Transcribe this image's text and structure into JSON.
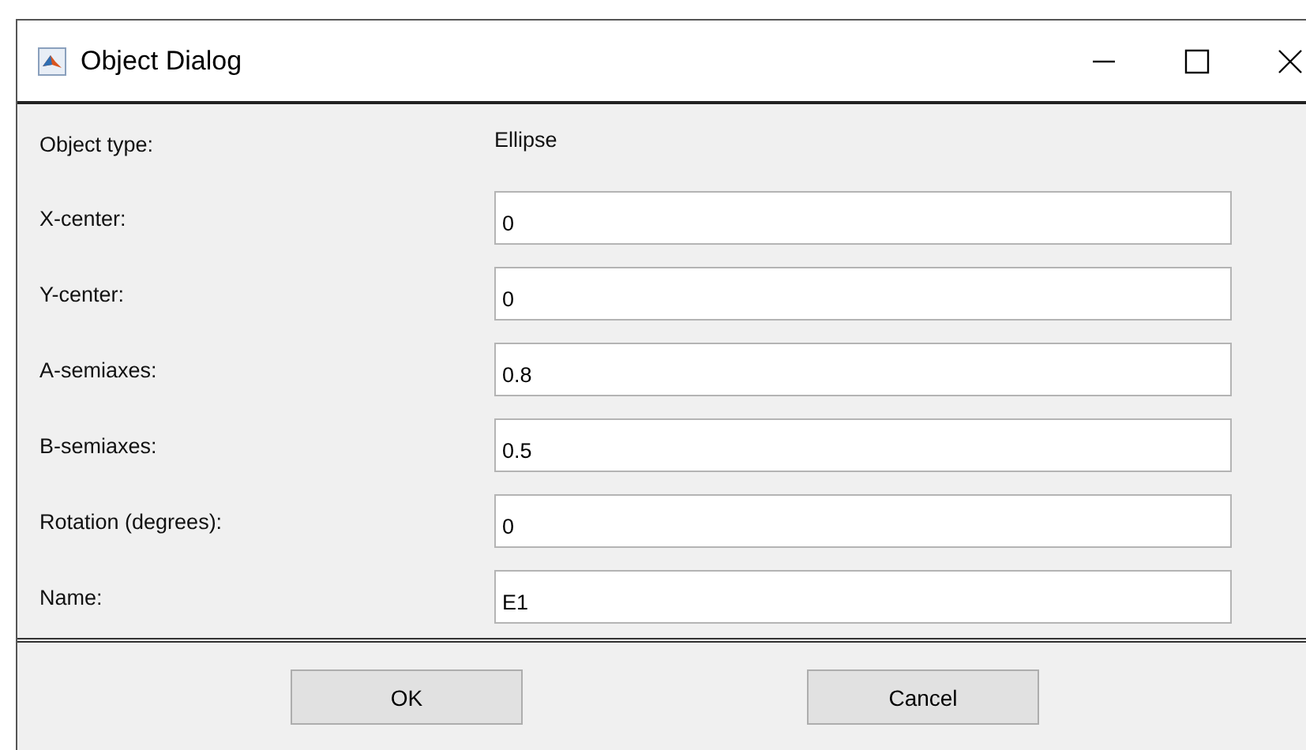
{
  "window": {
    "title": "Object Dialog"
  },
  "object_type": {
    "label": "Object type:",
    "value": "Ellipse"
  },
  "fields": [
    {
      "label": "X-center:",
      "value": "0"
    },
    {
      "label": "Y-center:",
      "value": "0"
    },
    {
      "label": "A-semiaxes:",
      "value": "0.8"
    },
    {
      "label": "B-semiaxes:",
      "value": "0.5"
    },
    {
      "label": "Rotation (degrees):",
      "value": "0"
    },
    {
      "label": "Name:",
      "value": "E1"
    }
  ],
  "buttons": [
    "OK",
    "Cancel"
  ]
}
